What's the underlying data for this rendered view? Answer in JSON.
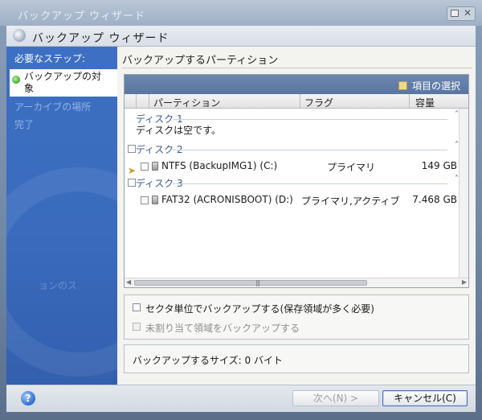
{
  "window": {
    "outer_title": "バックアップ ウィザード",
    "header_title": "バックアップ ウィザード"
  },
  "sidebar": {
    "heading": "必要なステップ:",
    "items": [
      {
        "label_line1": "バックアップの対",
        "label_line2": "象",
        "state": "active"
      },
      {
        "label": "アーカイブの場所",
        "state": "pending"
      },
      {
        "label": "完了",
        "state": "pending"
      }
    ],
    "faded_text": "ョンのス"
  },
  "content": {
    "section_title": "バックアップするパーティション",
    "select_items_label": "項目の選択",
    "columns": [
      "パーティション",
      "フラグ",
      "容量"
    ],
    "disks": [
      {
        "label": "ディスク 1",
        "empty_note": "ディスクは空です。",
        "partitions": []
      },
      {
        "label": "ディスク 2",
        "partitions": [
          {
            "name": "NTFS (BackupIMG1) (C:)",
            "flag": "プライマリ",
            "size": "149 GB"
          }
        ]
      },
      {
        "label": "ディスク 3",
        "partitions": [
          {
            "name": "FAT32 (ACRONISBOOT) (D:)",
            "flag": "プライマリ,アクティブ",
            "size": "7.468 GB"
          }
        ]
      }
    ],
    "options": {
      "sector_by_sector": "セクタ単位でバックアップする(保存領域が多く必要)",
      "unallocated": "未割り当て領域をバックアップする"
    },
    "backup_size_label": "バックアップするサイズ: 0 バイト"
  },
  "footer": {
    "help": "?",
    "next_label": "次へ(N) >",
    "cancel_label": "キャンセル(C)"
  }
}
